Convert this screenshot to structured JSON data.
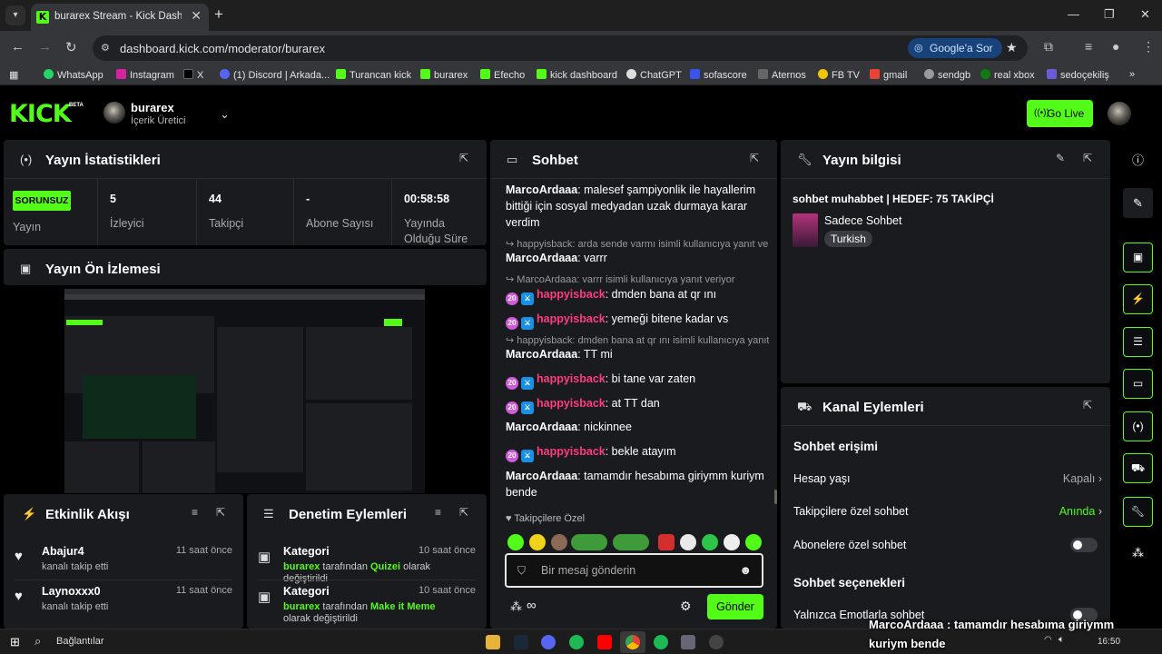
{
  "browser": {
    "tab_title": "burarex Stream - Kick Dashboard",
    "tab_close": "✕",
    "new_tab": "+",
    "url": "dashboard.kick.com/moderator/burarex",
    "google_sor": "Google'a Sor",
    "bookmarks": [
      "WhatsApp",
      "Instagram",
      "X",
      "(1) Discord | Arkada...",
      "Turancan kick",
      "burarex",
      "Efecho",
      "kick dashboard",
      "ChatGPT",
      "sofascore",
      "Aternos",
      "FB TV",
      "gmail",
      "sendgb",
      "real xbox",
      "sedoçekiliş"
    ]
  },
  "header": {
    "logo": "KICK",
    "beta": "BETA",
    "username": "burarex",
    "role": "İçerik Üretici",
    "go_live": "Go Live"
  },
  "stats": {
    "title": "Yayın İstatistikleri",
    "status_badge": "SORUNSUZ",
    "status_label": "Yayın",
    "viewers_value": "5",
    "viewers_label": "İzleyici",
    "followers_value": "44",
    "followers_label": "Takipçi",
    "subs_value": "-",
    "subs_label": "Abone Sayısı",
    "uptime_value": "00:58:58",
    "uptime_label": "Yayında Olduğu Süre"
  },
  "preview": {
    "title": "Yayın Ön İzlemesi"
  },
  "activity": {
    "title": "Etkinlik Akışı",
    "items": [
      {
        "name": "Abajur4",
        "sub": "kanalı takip etti",
        "time": "11 saat önce"
      },
      {
        "name": "Laynoxxx0",
        "sub": "kanalı takip etti",
        "time": "11 saat önce"
      }
    ]
  },
  "moderation": {
    "title": "Denetim Eylemleri",
    "items": [
      {
        "title": "Kategori",
        "time": "10 saat önce",
        "actor": "burarex",
        "mid": " tarafından ",
        "target": "Quizei",
        "end": " olarak değiştirildi"
      },
      {
        "title": "Kategori",
        "time": "10 saat önce",
        "actor": "burarex",
        "mid": " tarafından ",
        "target": "Make it Meme",
        "end": " olarak değiştirildi"
      }
    ]
  },
  "chat": {
    "title": "Sohbet",
    "m1_user": "MarcoArdaaa",
    "m1_text": ": malesef şampiyonlik ile hayallerim bittiği için sosyal medyadan uzak durmaya karar verdim",
    "r1": "happyisback: arda sende varmı isimli kullanıcıya yanıt veriyor",
    "m2_user": "MarcoArdaaa",
    "m2_text": ": varrr",
    "r2": "MarcoArdaaa: varrr isimli kullanıcıya yanıt veriyor",
    "m3_user": "happyisback",
    "m3_text": ": dmden bana at qr ını",
    "m4_user": "happyisback",
    "m4_text": ": yemeği bitene kadar vs",
    "r3": "happyisback: dmden bana at qr ını isimli kullanıcıya yanıt veriyor",
    "m5_user": "MarcoArdaaa",
    "m5_text": ": TT mi",
    "m6_user": "happyisback",
    "m6_text": ": bi tane var zaten",
    "m7_user": "happyisback",
    "m7_text": ": at TT dan",
    "m8_user": "MarcoArdaaa",
    "m8_text": ": nickinnee",
    "m9_user": "happyisback",
    "m9_text": ": bekle atayım",
    "m10_user": "MarcoArdaaa",
    "m10_text": ": tamamdır hesabıma giriymm kuriym bende",
    "sub_badge": "20",
    "followers_only": "Takipçilere Özel",
    "placeholder": "Bir mesaj gönderin",
    "send": "Gönder"
  },
  "stream_info": {
    "title": "Yayın bilgisi",
    "stream_title": "sohbet muhabbet | HEDEF: 75 TAKİPÇİ",
    "category": "Sadece Sohbet",
    "language": "Turkish"
  },
  "channel_actions": {
    "title": "Kanal Eylemleri",
    "chat_access": "Sohbet erişimi",
    "account_age": "Hesap yaşı",
    "account_age_val": "Kapalı",
    "followers_chat": "Takipçilere özel sohbet",
    "followers_chat_val": "Anında",
    "subs_chat": "Abonelere özel sohbet",
    "chat_options": "Sohbet seçenekleri",
    "emotes_only": "Yalnızca Emotlarla sohbet"
  },
  "taskbar": {
    "search": "Bağlantılar",
    "time": "16:50"
  },
  "overlay": {
    "line1": "MarcoArdaaa : tamamdır hesabıma giriymm",
    "line2": "kuriym bende"
  },
  "colors": {
    "accent": "#53fc18",
    "chat_pink": "#ff3c7d",
    "panel": "#191b1f"
  }
}
